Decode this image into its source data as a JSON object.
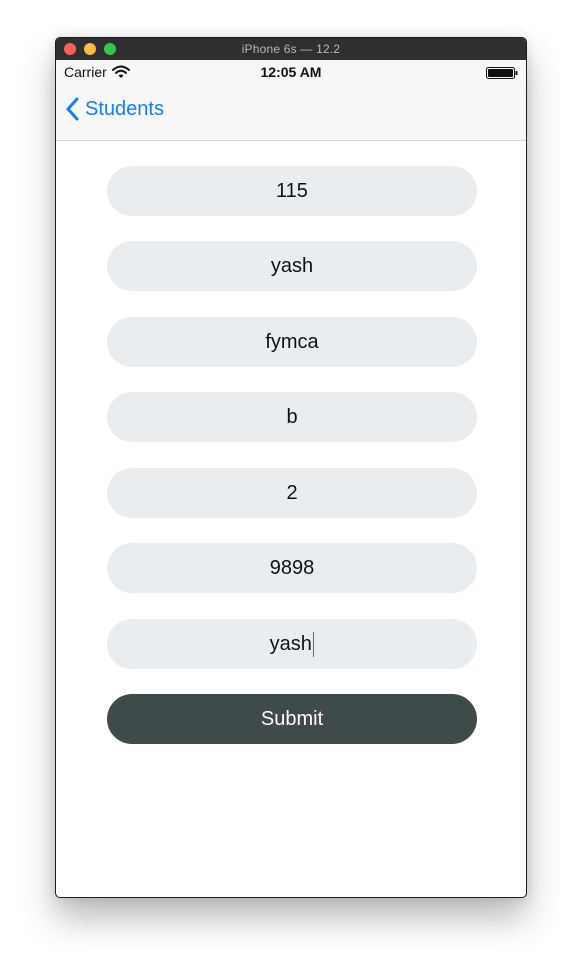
{
  "window": {
    "title": "iPhone 6s — 12.2"
  },
  "status_bar": {
    "carrier": "Carrier",
    "time": "12:05 AM",
    "icons": [
      "wifi-icon",
      "battery-icon"
    ]
  },
  "nav_bar": {
    "back_label": "Students",
    "back_icon": "chevron-left-icon",
    "tint_color": "#147efb"
  },
  "form": {
    "fields": [
      {
        "value": "115"
      },
      {
        "value": "yash"
      },
      {
        "value": "fymca"
      },
      {
        "value": "b"
      },
      {
        "value": "2"
      },
      {
        "value": "9898"
      },
      {
        "value": "yash",
        "focused": true
      }
    ],
    "field_background": "#e9edf0",
    "submit_label": "Submit",
    "submit_background": "#3f4a4a"
  }
}
